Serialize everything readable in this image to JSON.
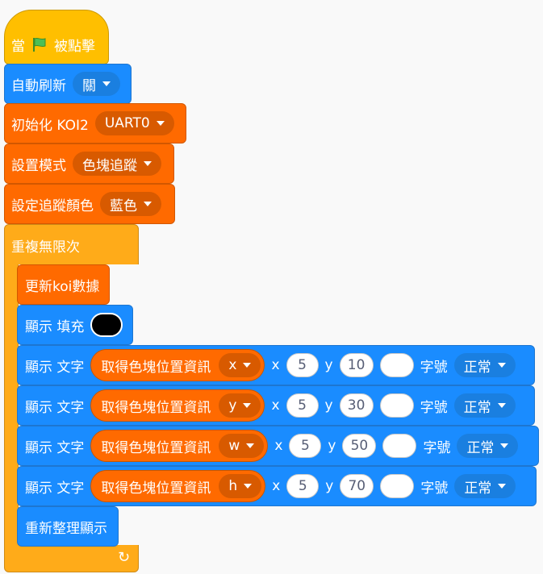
{
  "hat": {
    "when": "當",
    "clicked": "被點擊",
    "flag_icon": "green-flag-icon"
  },
  "auto_refresh": {
    "label": "自動刷新",
    "value": "關"
  },
  "init": {
    "label": "初始化 KOI2",
    "value": "UART0"
  },
  "set_mode": {
    "label": "設置模式",
    "value": "色塊追蹤"
  },
  "set_color": {
    "label": "設定追蹤顏色",
    "value": "藍色"
  },
  "forever": {
    "label": "重複無限次",
    "loop_icon": "loop-arrow-icon"
  },
  "update": {
    "label": "更新koi數據"
  },
  "fill": {
    "label": "顯示 填充",
    "color": "#000000"
  },
  "text_rows": [
    {
      "label": "顯示 文字",
      "reporter": "取得色塊位置資訊",
      "field": "x",
      "x_label": "x",
      "x_value": "5",
      "y_label": "y",
      "y_value": "10",
      "size_label": "字號",
      "size_value": "正常"
    },
    {
      "label": "顯示 文字",
      "reporter": "取得色塊位置資訊",
      "field": "y",
      "x_label": "x",
      "x_value": "5",
      "y_label": "y",
      "y_value": "30",
      "size_label": "字號",
      "size_value": "正常"
    },
    {
      "label": "顯示 文字",
      "reporter": "取得色塊位置資訊",
      "field": "w",
      "x_label": "x",
      "x_value": "5",
      "y_label": "y",
      "y_value": "50",
      "size_label": "字號",
      "size_value": "正常"
    },
    {
      "label": "顯示 文字",
      "reporter": "取得色塊位置資訊",
      "field": "h",
      "x_label": "x",
      "x_value": "5",
      "y_label": "y",
      "y_value": "70",
      "size_label": "字號",
      "size_value": "正常"
    }
  ],
  "refresh": {
    "label": "重新整理顯示"
  },
  "colors": {
    "event": "#ffbf00",
    "display": "#1a8cff",
    "koi": "#ff6a00",
    "control": "#ffab19"
  }
}
